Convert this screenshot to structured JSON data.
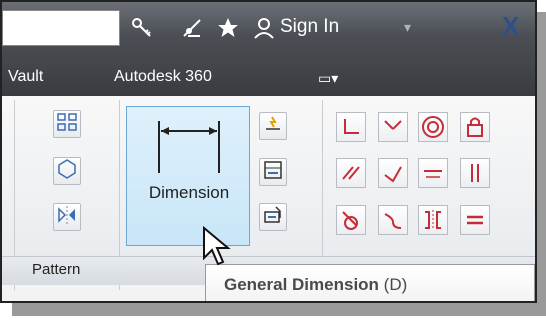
{
  "toolbar": {
    "search_placeholder": "",
    "key_icon": "key-icon",
    "satellite_icon": "satellite-icon",
    "star_icon": "star-icon",
    "user_icon": "user-icon",
    "sign_in_label": "Sign In",
    "dropdown_glyph": "▾",
    "x_glyph": "X"
  },
  "menu": {
    "items": [
      "Vault",
      "Autodesk 360"
    ],
    "camera_glyph": "▭▾"
  },
  "ribbon": {
    "dimension_label": "Dimension",
    "pattern_label": "Pattern",
    "left_icons": [
      "connect-icon",
      "polygon-icon",
      "mirror-icon"
    ],
    "middle_icons": [
      "show-constraints-icon",
      "bar-icon",
      "measure-icon"
    ],
    "constraint_icons": [
      "coincident-icon",
      "tangent-arc-icon",
      "concentric-icon",
      "fix-icon",
      "parallel-icon",
      "perpendicular-icon",
      "horizontal-icon",
      "vertical-icon",
      "tangent-icon",
      "smooth-icon",
      "symmetric-icon",
      "equal-icon"
    ]
  },
  "tooltip": {
    "title": "General Dimension",
    "shortcut": "(D)"
  }
}
